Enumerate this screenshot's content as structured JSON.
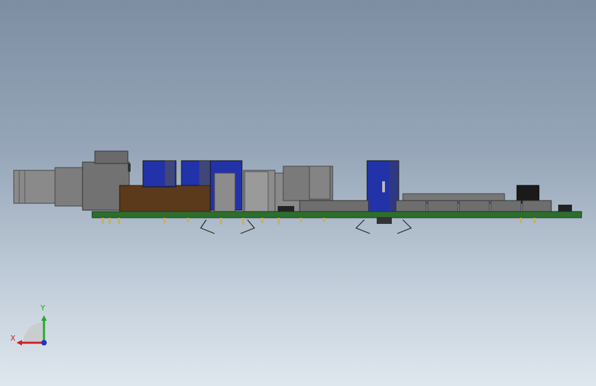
{
  "colors": {
    "background_top": "#7d8ea3",
    "background_bottom": "#dfe7ee",
    "pcb": "#2d6e2d",
    "capacitor": "#2233aa",
    "connector_body": "#7a7a7a",
    "relay": "#5a3a1a",
    "axis_x": "#cc2222",
    "axis_y": "#22aa22",
    "axis_z": "#2233cc"
  },
  "triad": {
    "x_label": "X",
    "y_label": "Y"
  },
  "icons": {
    "triad": "axis-triad-icon"
  }
}
